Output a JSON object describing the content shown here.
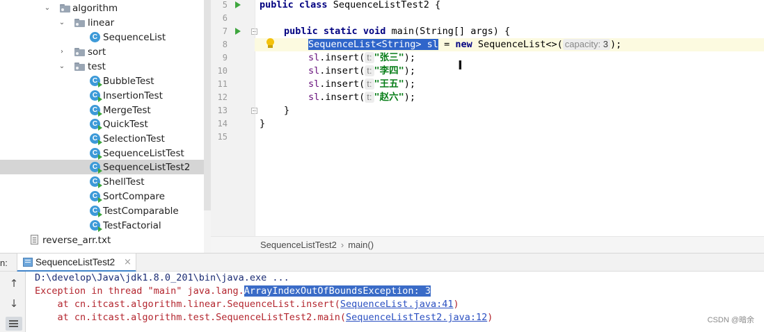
{
  "project_tree": {
    "items": [
      {
        "label": "algorithm",
        "type": "package",
        "expanded": true
      },
      {
        "label": "linear",
        "type": "package",
        "expanded": true
      },
      {
        "label": "SequenceList",
        "type": "class"
      },
      {
        "label": "sort",
        "type": "package",
        "expanded": false
      },
      {
        "label": "test",
        "type": "package",
        "expanded": true
      },
      {
        "label": "BubbleTest",
        "type": "class-runnable"
      },
      {
        "label": "InsertionTest",
        "type": "class-runnable"
      },
      {
        "label": "MergeTest",
        "type": "class-runnable"
      },
      {
        "label": "QuickTest",
        "type": "class-runnable"
      },
      {
        "label": "SelectionTest",
        "type": "class-runnable"
      },
      {
        "label": "SequenceListTest",
        "type": "class-runnable"
      },
      {
        "label": "SequenceListTest2",
        "type": "class-runnable",
        "selected": true
      },
      {
        "label": "ShellTest",
        "type": "class-runnable"
      },
      {
        "label": "SortCompare",
        "type": "class-runnable"
      },
      {
        "label": "TestComparable",
        "type": "class-runnable"
      },
      {
        "label": "TestFactorial",
        "type": "class-runnable"
      },
      {
        "label": "reverse_arr.txt",
        "type": "text-file"
      }
    ],
    "class_icon_letter": "C"
  },
  "editor": {
    "line_numbers": [
      "5",
      "6",
      "7",
      "8",
      "9",
      "10",
      "11",
      "12",
      "13",
      "14",
      "15"
    ],
    "code": {
      "line5": {
        "kw1": "public",
        "kw2": "class",
        "rest": " SequenceListTest2 {"
      },
      "line7": {
        "kw1": "public",
        "kw2": "static",
        "kw3": "void",
        "rest": " main(String[] args) {"
      },
      "line8": {
        "selected": "SequenceList<String> sl",
        "mid": " = ",
        "kw": "new",
        "ctor": " SequenceList<>(",
        "hint_name": "capacity:",
        "hint_value": "3",
        "end": ");"
      },
      "insert_lines": [
        {
          "var": "sl",
          "call": ".insert(",
          "hint": "t:",
          "arg": "\"张三\"",
          "end": ");"
        },
        {
          "var": "sl",
          "call": ".insert(",
          "hint": "t:",
          "arg": "\"李四\"",
          "end": ");"
        },
        {
          "var": "sl",
          "call": ".insert(",
          "hint": "t:",
          "arg": "\"王五\"",
          "end": ");"
        },
        {
          "var": "sl",
          "call": ".insert(",
          "hint": "t:",
          "arg": "\"赵六\"",
          "end": ");"
        }
      ],
      "line13": "}",
      "line14": "}"
    },
    "cursor_glyph": "I"
  },
  "breadcrumb": {
    "items": [
      "SequenceListTest2",
      "main()"
    ],
    "separator": "›"
  },
  "run_panel": {
    "label": "n:",
    "tab_label": "SequenceListTest2",
    "tab_close": "×",
    "side_buttons": {
      "up": "↑",
      "down": "↓"
    },
    "console": {
      "command": "D:\\develop\\Java\\jdk1.8.0_201\\bin\\java.exe ...",
      "exception_prefix": "Exception in thread \"main\" java.lang.",
      "exception_name": "ArrayIndexOutOfBoundsException: 3",
      "trace": [
        {
          "prefix": "    at cn.itcast.algorithm.linear.SequenceList.insert(",
          "link": "SequenceList.java:41",
          "suffix": ")"
        },
        {
          "prefix": "    at cn.itcast.algorithm.test.SequenceListTest2.main(",
          "link": "SequenceListTest2.java:12",
          "suffix": ")"
        }
      ]
    }
  },
  "watermark": "CSDN @暗余",
  "colors": {
    "keyword": "#000080",
    "string": "#067d17",
    "selection": "#2f65ca",
    "error_text": "#b3252e",
    "link": "#2a4fc1",
    "class_icon": "#3d9ad8"
  }
}
